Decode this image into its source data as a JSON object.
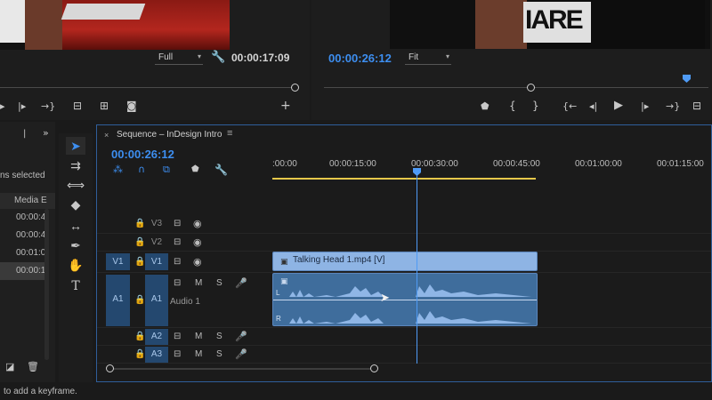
{
  "source_monitor": {
    "zoom": "Full",
    "timecode": "00:00:17:09"
  },
  "program_monitor": {
    "zoom": "Fit",
    "timecode": "00:00:26:12",
    "shirt_text": "IARE"
  },
  "project_panel": {
    "selection_text": "ns selected",
    "column_header": "Media E",
    "rows": [
      "00:00:4",
      "00:00:4",
      "00:01:0",
      "00:00:1"
    ]
  },
  "timeline": {
    "tab_title": "Sequence – InDesign Intro",
    "timecode": "00:00:26:12",
    "ruler_labels": [
      ":00:00",
      "00:00:15:00",
      "00:00:30:00",
      "00:00:45:00",
      "00:01:00:00",
      "00:01:15:00"
    ],
    "video_tracks": [
      {
        "name": "V3"
      },
      {
        "name": "V2"
      },
      {
        "name": "V1",
        "source": "V1"
      }
    ],
    "audio_tracks": [
      {
        "name": "A1",
        "source": "A1",
        "label": "Audio 1"
      },
      {
        "name": "A2"
      },
      {
        "name": "A3"
      }
    ],
    "video_clip_label": "Talking Head 1.mp4 [V]",
    "audio_channel_labels": [
      "L",
      "R"
    ],
    "mute_label": "M",
    "solo_label": "S"
  },
  "status_bar": {
    "text": "to add a keyframe."
  },
  "colors": {
    "accent_blue": "#3d8ef0",
    "video_clip": "#8eb4e4",
    "audio_clip": "#3f6d9c",
    "work_area": "#e5c84a"
  }
}
